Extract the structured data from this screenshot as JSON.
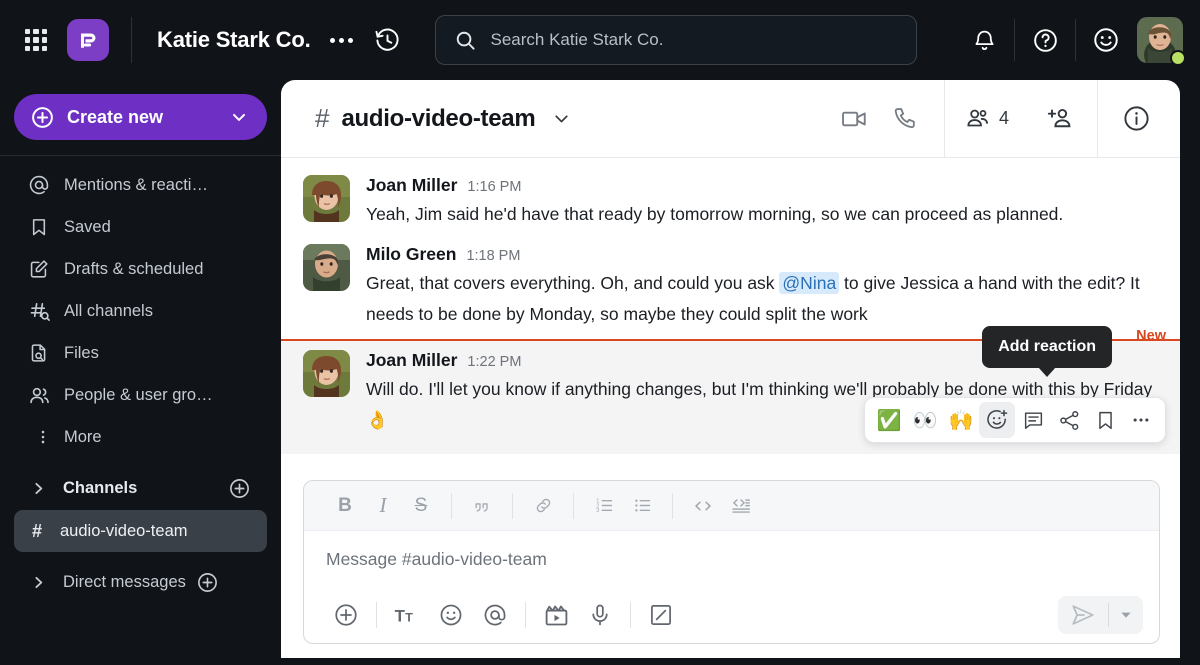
{
  "topbar": {
    "grid_icon": "apps-grid-icon",
    "logo_icon": "pumble-logo-icon",
    "workspace_title": "Katie Stark Co.",
    "more_icon": "ellipsis-icon",
    "history_icon": "history-clock-icon",
    "search": {
      "icon": "search-icon",
      "placeholder": "Search Katie Stark Co."
    },
    "notifications_icon": "bell-icon",
    "help_icon": "question-circle-icon",
    "status_icon": "smiley-face-icon",
    "avatar_name": "user-avatar",
    "presence_color": "#b8e062"
  },
  "sidebar": {
    "create_new": {
      "label": "Create new",
      "plus_icon": "plus-circle-icon",
      "chevron_icon": "chevron-down-icon",
      "color": "#6d2fc4"
    },
    "items": [
      {
        "label": "Mentions & reacti…",
        "icon": "at-sign-icon"
      },
      {
        "label": "Saved",
        "icon": "bookmark-icon"
      },
      {
        "label": "Drafts & scheduled",
        "icon": "draft-pencil-icon"
      },
      {
        "label": "All channels",
        "icon": "hash-search-icon"
      },
      {
        "label": "Files",
        "icon": "file-search-icon"
      },
      {
        "label": "People & user gro…",
        "icon": "people-icon"
      },
      {
        "label": "More",
        "icon": "vertical-dots-icon"
      }
    ],
    "channels_section": {
      "label": "Channels",
      "chevron_icon": "chevron-right-icon",
      "add_icon": "plus-circle-icon"
    },
    "channels": [
      {
        "label": "audio-video-team",
        "hash": "#",
        "active": true
      }
    ],
    "dm_section": {
      "label": "Direct messages",
      "chevron_icon": "chevron-right-icon",
      "add_icon": "plus-circle-icon"
    }
  },
  "channel_header": {
    "hash": "#",
    "name": "audio-video-team",
    "chevron_icon": "chevron-down-icon",
    "video_icon": "video-camera-icon",
    "call_icon": "phone-icon",
    "members_icon": "members-icon",
    "member_count": "4",
    "add_member_icon": "add-person-icon",
    "info_icon": "info-circle-icon"
  },
  "messages": [
    {
      "author": "Joan Miller",
      "time": "1:16 PM",
      "avatar": "joan-miller-avatar",
      "text_before": "Yeah, Jim said he'd have that ready by tomorrow morning, so we can proceed as planned.",
      "mention": "",
      "text_after": "",
      "emoji": ""
    },
    {
      "author": "Milo Green",
      "time": "1:18 PM",
      "avatar": "milo-green-avatar",
      "text_before": "Great, that covers everything. Oh, and could you ask ",
      "mention": "@Nina",
      "text_after": " to give Jessica a hand with the edit? It needs to be done by Monday, so maybe they could split the work",
      "emoji": ""
    },
    {
      "author": "Joan Miller",
      "time": "1:22 PM",
      "avatar": "joan-miller-avatar",
      "text_before": "Will do. I'll let you know if anything changes, but I'm thinking we'll probably be done with this by Friday ",
      "mention": "",
      "text_after": "",
      "emoji": "👌"
    }
  ],
  "new_divider": {
    "label": "New",
    "color": "#d9481e"
  },
  "action_bar": {
    "tooltip": "Add reaction",
    "buttons": [
      {
        "name": "reaction-white-check-mark",
        "glyph": "✅",
        "selected": false
      },
      {
        "name": "reaction-eyes",
        "glyph": "👀",
        "selected": false
      },
      {
        "name": "reaction-raised-hands",
        "glyph": "🙌",
        "selected": false
      },
      {
        "name": "add-reaction-icon",
        "glyph": "",
        "selected": true
      },
      {
        "name": "reply-in-thread-icon",
        "glyph": "",
        "selected": false
      },
      {
        "name": "share-message-icon",
        "glyph": "",
        "selected": false
      },
      {
        "name": "save-message-icon",
        "glyph": "",
        "selected": false
      },
      {
        "name": "more-actions-icon",
        "glyph": "",
        "selected": false
      }
    ]
  },
  "composer": {
    "placeholder": "Message #audio-video-team",
    "format_buttons": [
      {
        "name": "bold-icon",
        "label": "B"
      },
      {
        "name": "italic-icon",
        "label": "I"
      },
      {
        "name": "strikethrough-icon",
        "label": "S"
      },
      {
        "name": "blockquote-icon",
        "label": "❝"
      },
      {
        "name": "link-icon",
        "label": ""
      },
      {
        "name": "ordered-list-icon",
        "label": ""
      },
      {
        "name": "bullet-list-icon",
        "label": ""
      },
      {
        "name": "inline-code-icon",
        "label": "<>"
      },
      {
        "name": "code-block-icon",
        "label": ""
      }
    ],
    "bottom_buttons": [
      {
        "name": "attach-plus-icon"
      },
      {
        "name": "text-formatting-icon"
      },
      {
        "name": "emoji-icon"
      },
      {
        "name": "mention-icon"
      },
      {
        "name": "video-clip-icon"
      },
      {
        "name": "microphone-icon"
      },
      {
        "name": "whiteboard-icon"
      }
    ],
    "send_icon": "send-plane-icon",
    "send_chevron_icon": "chevron-down-icon"
  }
}
